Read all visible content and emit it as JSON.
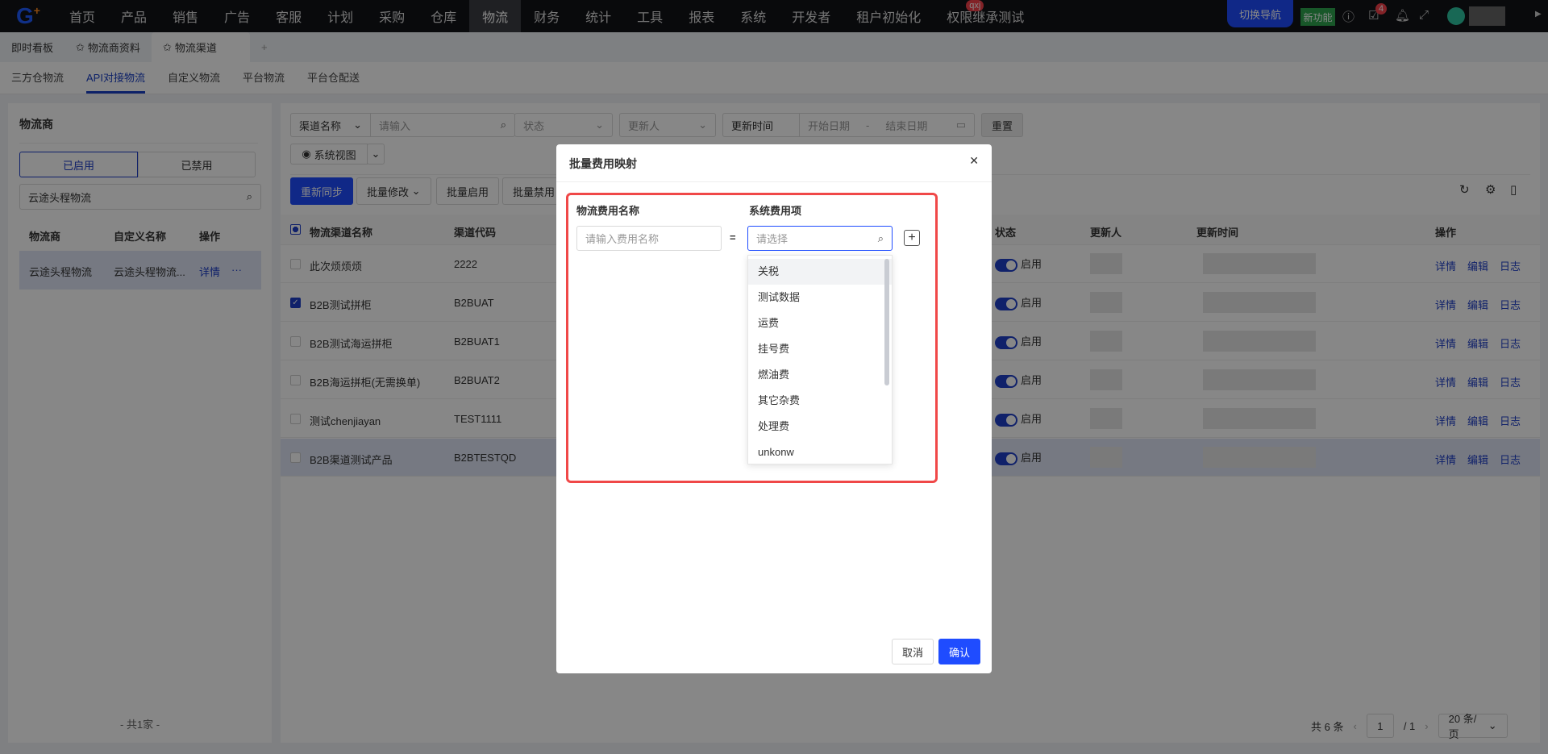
{
  "topnav": {
    "items": [
      "首页",
      "产品",
      "销售",
      "广告",
      "客服",
      "计划",
      "采购",
      "仓库",
      "物流",
      "财务",
      "统计",
      "工具",
      "报表",
      "系统",
      "开发者",
      "租户初始化",
      "权限继承测试"
    ],
    "active": "物流",
    "tag_badge": "qxj",
    "switch_nav": "切换导航",
    "new_feature": "新功能",
    "task_count": "4"
  },
  "tabs": {
    "items": [
      "即时看板",
      "物流商资料",
      "物流渠道"
    ],
    "add": "+"
  },
  "subtabs": [
    "三方仓物流",
    "API对接物流",
    "自定义物流",
    "平台物流",
    "平台仓配送"
  ],
  "left": {
    "title": "物流商",
    "enabled": "已启用",
    "disabled": "已禁用",
    "search_value": "云途头程物流",
    "headers": [
      "物流商",
      "自定义名称",
      "操作"
    ],
    "rows": [
      {
        "name": "云途头程物流",
        "custom": "云途头程物流...",
        "detail": "详情",
        "more": "···"
      }
    ],
    "total": "- 共1家 -"
  },
  "filters": {
    "channel_select": "渠道名称",
    "channel_placeholder": "请输入",
    "status": "状态",
    "updater": "更新人",
    "time_label": "更新时间",
    "start": "开始日期",
    "sep": "-",
    "end": "结束日期",
    "reset": "重置",
    "view": "系统视图"
  },
  "toolbar": {
    "resync": "重新同步",
    "batch_edit": "批量修改",
    "batch_enable": "批量启用",
    "batch_disable": "批量禁用"
  },
  "table": {
    "headers": [
      "物流渠道名称",
      "渠道代码",
      "状态",
      "更新人",
      "更新时间",
      "操作"
    ],
    "rows": [
      {
        "name": "此次烦烦烦",
        "code": "2222",
        "status": "启用",
        "checked": false
      },
      {
        "name": "B2B测试拼柜",
        "code": "B2BUAT",
        "status": "启用",
        "checked": true
      },
      {
        "name": "B2B测试海运拼柜",
        "code": "B2BUAT1",
        "status": "启用",
        "checked": false
      },
      {
        "name": "B2B海运拼柜(无需换单)",
        "code": "B2BUAT2",
        "status": "启用",
        "checked": false
      },
      {
        "name": "测试chenjiayan",
        "code": "TEST1111",
        "status": "启用",
        "checked": false
      },
      {
        "name": "B2B渠道测试产品",
        "code": "B2BTESTQD",
        "status": "启用",
        "checked": false
      }
    ],
    "actions": [
      "详情",
      "编辑",
      "日志"
    ]
  },
  "pagination": {
    "total": "共 6 条",
    "page": "1",
    "pages": "/ 1",
    "size": "20 条/页"
  },
  "modal": {
    "title": "批量费用映射",
    "col1": "物流费用名称",
    "col2": "系统费用项",
    "name_placeholder": "请输入费用名称",
    "eq": "=",
    "select_placeholder": "请选择",
    "options": [
      "关税",
      "测试数据",
      "运费",
      "挂号费",
      "燃油费",
      "其它杂费",
      "处理费",
      "unkonw"
    ],
    "cancel": "取消",
    "confirm": "确认"
  }
}
